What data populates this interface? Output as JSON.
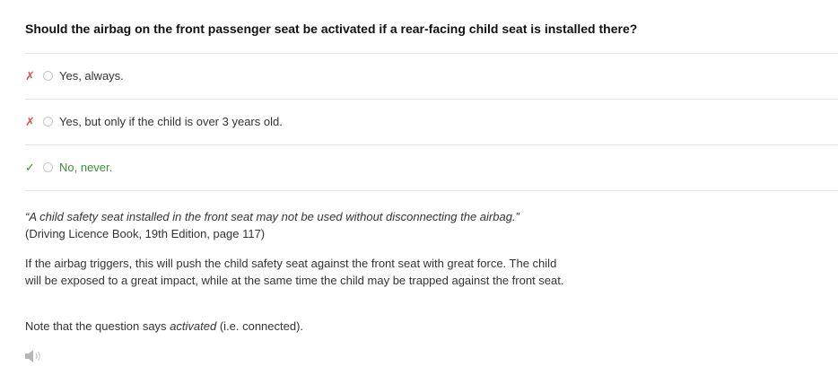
{
  "question": {
    "text": "Should the airbag on the front passenger seat be activated if a rear-facing child seat is installed there?"
  },
  "answers": [
    {
      "mark": "✗",
      "status": "wrong",
      "label": "Yes, always."
    },
    {
      "mark": "✗",
      "status": "wrong",
      "label": "Yes, but only if the child is over 3 years old."
    },
    {
      "mark": "✓",
      "status": "correct",
      "label": "No, never."
    }
  ],
  "explanation": {
    "quote": "“A child safety seat installed in the front seat may not be used without disconnecting the airbag.”",
    "source": "(Driving Licence Book, 19th Edition, page 117)",
    "paragraph": "If the airbag triggers, this will push the child safety seat against the front seat with great force. The child will be exposed to a great impact, while at the same time the child may be trapped against the front seat.",
    "note_prefix": "Note that the question says ",
    "note_emphasis": "activated",
    "note_suffix": " (i.e. connected)."
  },
  "icons": {
    "audio": "speaker-icon"
  },
  "colors": {
    "wrong": "#d9534f",
    "correct": "#3c8d3c"
  }
}
